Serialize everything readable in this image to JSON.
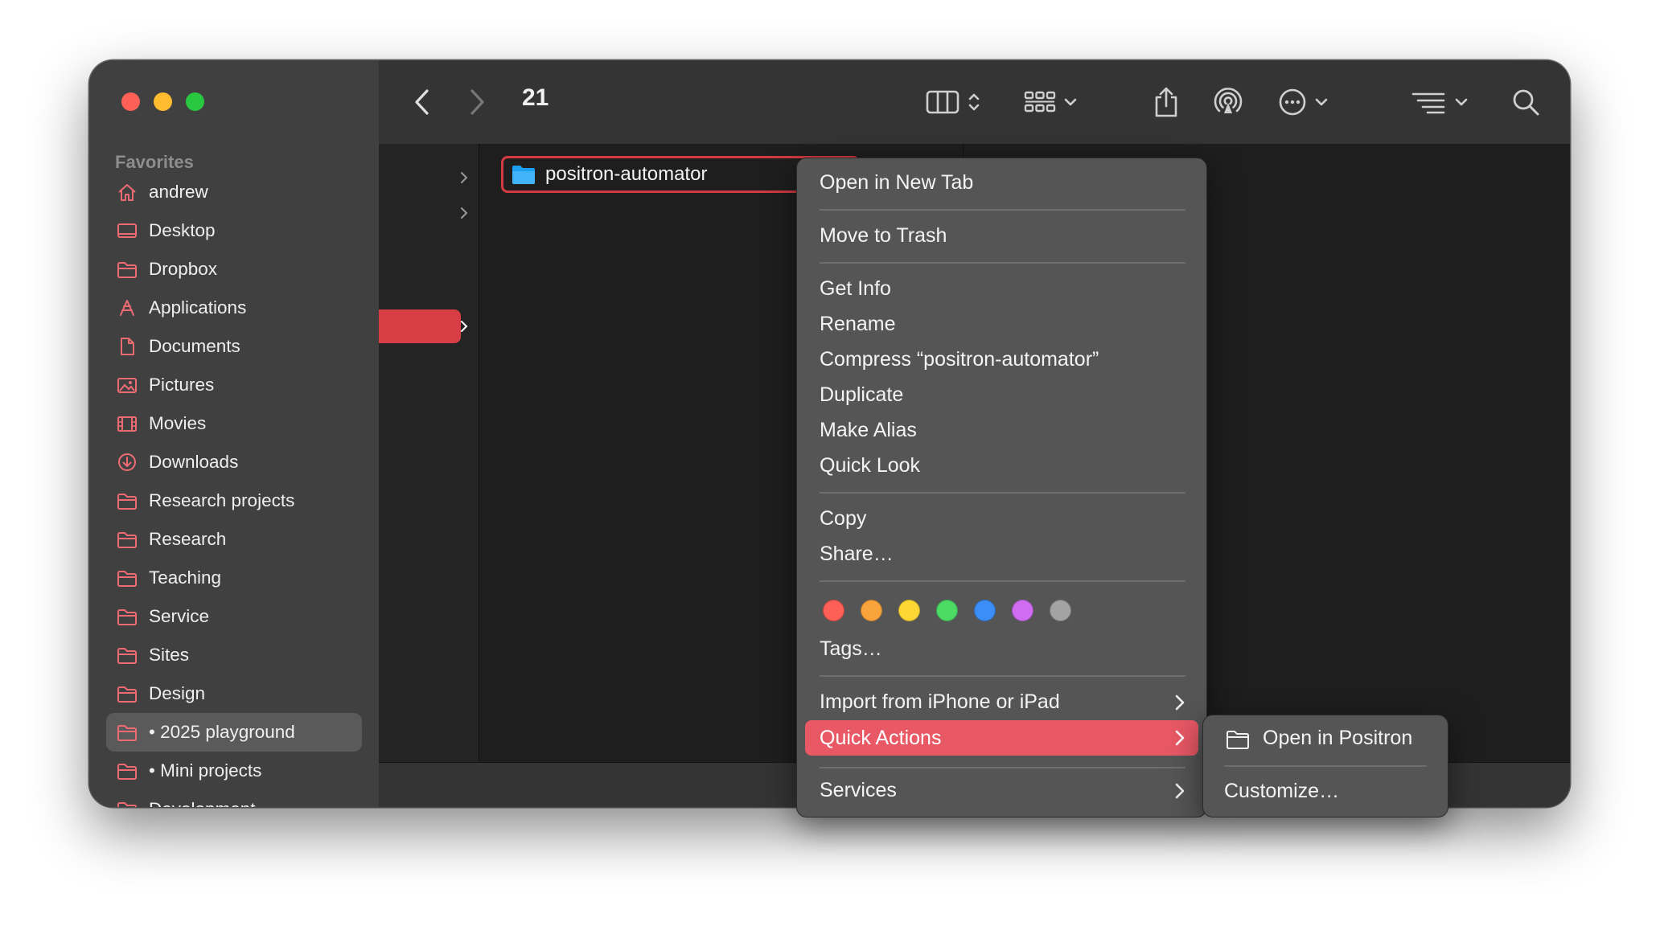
{
  "window": {
    "title": "21",
    "traffic_lights": {
      "close": "#fe5f57",
      "minimize": "#febc2e",
      "zoom": "#28c840"
    }
  },
  "sidebar": {
    "heading": "Favorites",
    "items": [
      {
        "label": "andrew",
        "icon": "home-icon"
      },
      {
        "label": "Desktop",
        "icon": "desktop-icon"
      },
      {
        "label": "Dropbox",
        "icon": "folder-icon"
      },
      {
        "label": "Applications",
        "icon": "applications-icon"
      },
      {
        "label": "Documents",
        "icon": "document-icon"
      },
      {
        "label": "Pictures",
        "icon": "photo-icon"
      },
      {
        "label": "Movies",
        "icon": "film-icon"
      },
      {
        "label": "Downloads",
        "icon": "download-icon"
      },
      {
        "label": "Research projects",
        "icon": "folder-icon"
      },
      {
        "label": "Research",
        "icon": "folder-icon"
      },
      {
        "label": "Teaching",
        "icon": "folder-icon"
      },
      {
        "label": "Service",
        "icon": "folder-icon"
      },
      {
        "label": "Sites",
        "icon": "folder-icon"
      },
      {
        "label": "Design",
        "icon": "folder-icon"
      },
      {
        "label": "• 2025 playground",
        "icon": "folder-icon",
        "selected": true
      },
      {
        "label": "• Mini projects",
        "icon": "folder-icon"
      },
      {
        "label": "Development",
        "icon": "folder-icon"
      }
    ],
    "icon_color": "#ef6b73"
  },
  "toolbar": {
    "back": "chevron-left-icon",
    "forward": "chevron-right-icon",
    "view": "column-view-icon",
    "group": "grid-icon",
    "share": "share-icon",
    "airdrop": "airdrop-icon",
    "action": "more-icon",
    "sort": "list-icon",
    "search": "search-icon"
  },
  "browser": {
    "selected_file": "positron-automator",
    "accent": "#d83d45"
  },
  "context_menu": {
    "open_new_tab": "Open in New Tab",
    "move_trash": "Move to Trash",
    "get_info": "Get Info",
    "rename": "Rename",
    "compress": "Compress “positron-automator”",
    "duplicate": "Duplicate",
    "make_alias": "Make Alias",
    "quick_look": "Quick Look",
    "copy": "Copy",
    "share": "Share…",
    "tag_colors": [
      "#fe5f57",
      "#f8a33c",
      "#fdd835",
      "#4cd964",
      "#3b8ef5",
      "#cf6cf2",
      "#a3a3a3"
    ],
    "tags": "Tags…",
    "import": "Import from iPhone or iPad",
    "quick_actions": "Quick Actions",
    "services": "Services",
    "highlight": "#e85865"
  },
  "submenu": {
    "open_positron": "Open in Positron",
    "customize": "Customize…"
  }
}
